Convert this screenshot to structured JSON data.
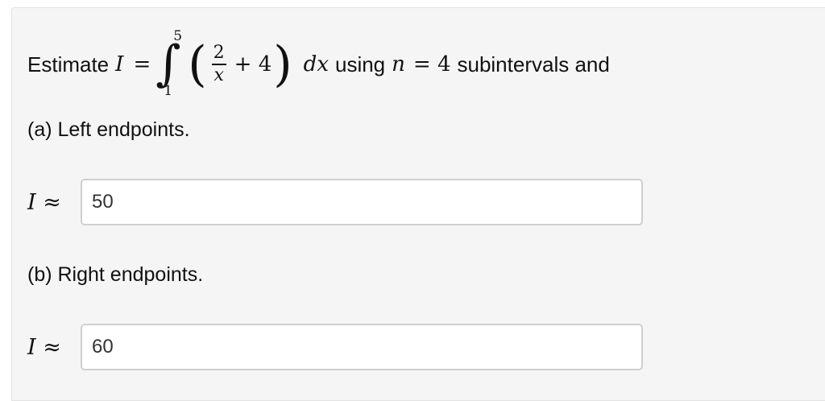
{
  "question": {
    "prefix": "Estimate",
    "var_I": "I",
    "equals": "=",
    "int_upper": "5",
    "int_lower": "1",
    "frac_num": "2",
    "frac_den": "x",
    "plus_term": "+ 4",
    "dx": "dx",
    "using": "using",
    "n_var": "n",
    "n_eq": "= 4",
    "suffix": "subintervals and"
  },
  "part_a": {
    "label": "(a) Left endpoints.",
    "approx_var": "I",
    "approx_sym": "≈",
    "value": "50"
  },
  "part_b": {
    "label": "(b) Right endpoints.",
    "approx_var": "I",
    "approx_sym": "≈",
    "value": "60"
  }
}
